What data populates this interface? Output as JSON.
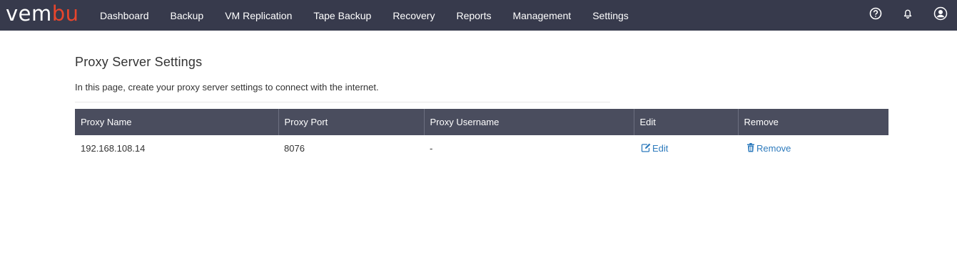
{
  "brand": {
    "logo_prefix": "vem",
    "logo_suffix": "bu"
  },
  "nav": {
    "items": [
      "Dashboard",
      "Backup",
      "VM Replication",
      "Tape Backup",
      "Recovery",
      "Reports",
      "Management",
      "Settings"
    ],
    "icons": [
      "help-circle-icon",
      "bell-icon",
      "user-profile-icon"
    ]
  },
  "page": {
    "title": "Proxy Server Settings",
    "description": "In this page, create your proxy server settings to connect with the internet."
  },
  "table": {
    "headers": [
      "Proxy Name",
      "Proxy Port",
      "Proxy Username",
      "Edit",
      "Remove"
    ],
    "rows": [
      {
        "name": "192.168.108.14",
        "port": "8076",
        "username": "-",
        "edit": "Edit",
        "remove": "Remove"
      }
    ]
  },
  "colors": {
    "topbar": "#373a4c",
    "table_header": "#4a4d5e",
    "link": "#2e7bbd",
    "brand_accent": "#e8452c"
  }
}
